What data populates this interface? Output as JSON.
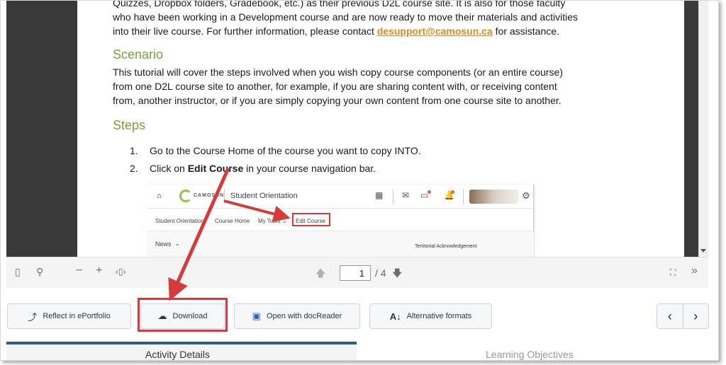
{
  "document": {
    "intro_lines": [
      "Quizzes, Dropbox folders, Gradebook, etc.) as their previous D2L course site.  It is also for those faculty",
      "who have been working in a Development course and are now ready to move their materials and activities"
    ],
    "intro_last_prefix": "into their live course.  For further information, please contact ",
    "support_email": "desupport@camosun.ca",
    "intro_last_suffix": " for assistance.",
    "scenario_heading": "Scenario",
    "scenario_lines": [
      "This tutorial will cover the steps involved when you wish copy course components (or an entire course)",
      "from one D2L course site to another, for example, if you are sharing content with, or receiving content",
      "from, another instructor, or if you are simply copying your own content from one course site to another."
    ],
    "steps_heading": "Steps",
    "step1_num": "1.",
    "step1_text": "Go to the Course Home of the course you want to copy INTO.",
    "step2_num": "2.",
    "step2_prefix": "Click on ",
    "step2_bold": "Edit Course",
    "step2_suffix": " in your course navigation bar."
  },
  "inner_screenshot": {
    "brand": "CAMOSUN",
    "course_title": "Student Orientation",
    "nav_items": [
      "Student Orientation",
      "Course Home",
      "My Tools",
      "Edit Course"
    ],
    "news_label": "News",
    "territorial": "Territorial Acknowledgement"
  },
  "viewer_toolbar": {
    "page_current": "1",
    "page_total": "/ 4"
  },
  "actions": {
    "reflect": "Reflect in ePortfolio",
    "download": "Download",
    "open_docreader": "Open with docReader",
    "alt_formats": "Alternative formats"
  },
  "tabs": {
    "activity_details": "Activity Details",
    "learning_objectives": "Learning Objectives"
  },
  "colors": {
    "heading_green": "#77a43a",
    "email_orange": "#e08a1e",
    "annotation_red": "#d63b3b",
    "tab_active": "#2f5d86"
  }
}
